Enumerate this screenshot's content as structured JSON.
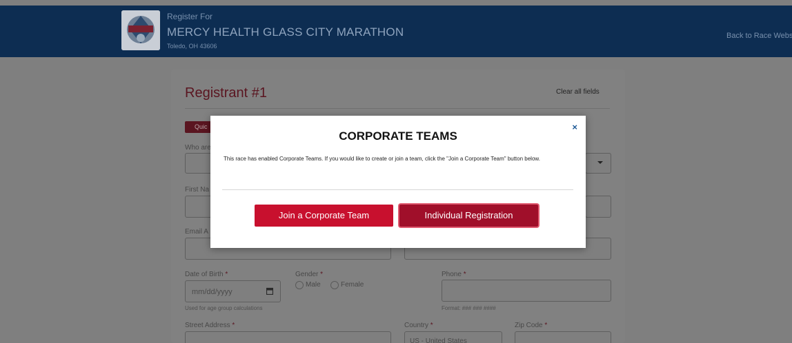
{
  "header": {
    "register_for": "Register For",
    "race_name": "MERCY HEALTH GLASS CITY MARATHON",
    "location": "Toledo, OH 43606",
    "back_link": "Back to Race Website ✕"
  },
  "form": {
    "title": "Registrant #1",
    "clear_all": "Clear all fields",
    "quick_label": "Quic",
    "who_label": "Who are",
    "first_name_label": "First Na",
    "email_label": "Email A",
    "dob_label": "Date of Birth",
    "dob_placeholder": "mm/dd/yyyy",
    "dob_hint": "Used for age group calculations",
    "gender_label": "Gender",
    "gender_options": [
      "Male",
      "Female"
    ],
    "phone_label": "Phone",
    "phone_hint": "Format: ### ### ####",
    "street_label": "Street Address",
    "country_label": "Country",
    "country_value": "US - United States",
    "zip_label": "Zip Code",
    "required_mark": "*"
  },
  "modal": {
    "title": "CORPORATE TEAMS",
    "body": "This race has enabled Corporate Teams. If you would like to create or join a team, click the \"Join a Corporate Team\" button below.",
    "close": "×",
    "join_button": "Join a Corporate Team",
    "individual_button": "Individual Registration"
  },
  "colors": {
    "header_bg": "#0d2d52",
    "accent": "#c8102e",
    "accent_dark": "#a00f2a"
  }
}
